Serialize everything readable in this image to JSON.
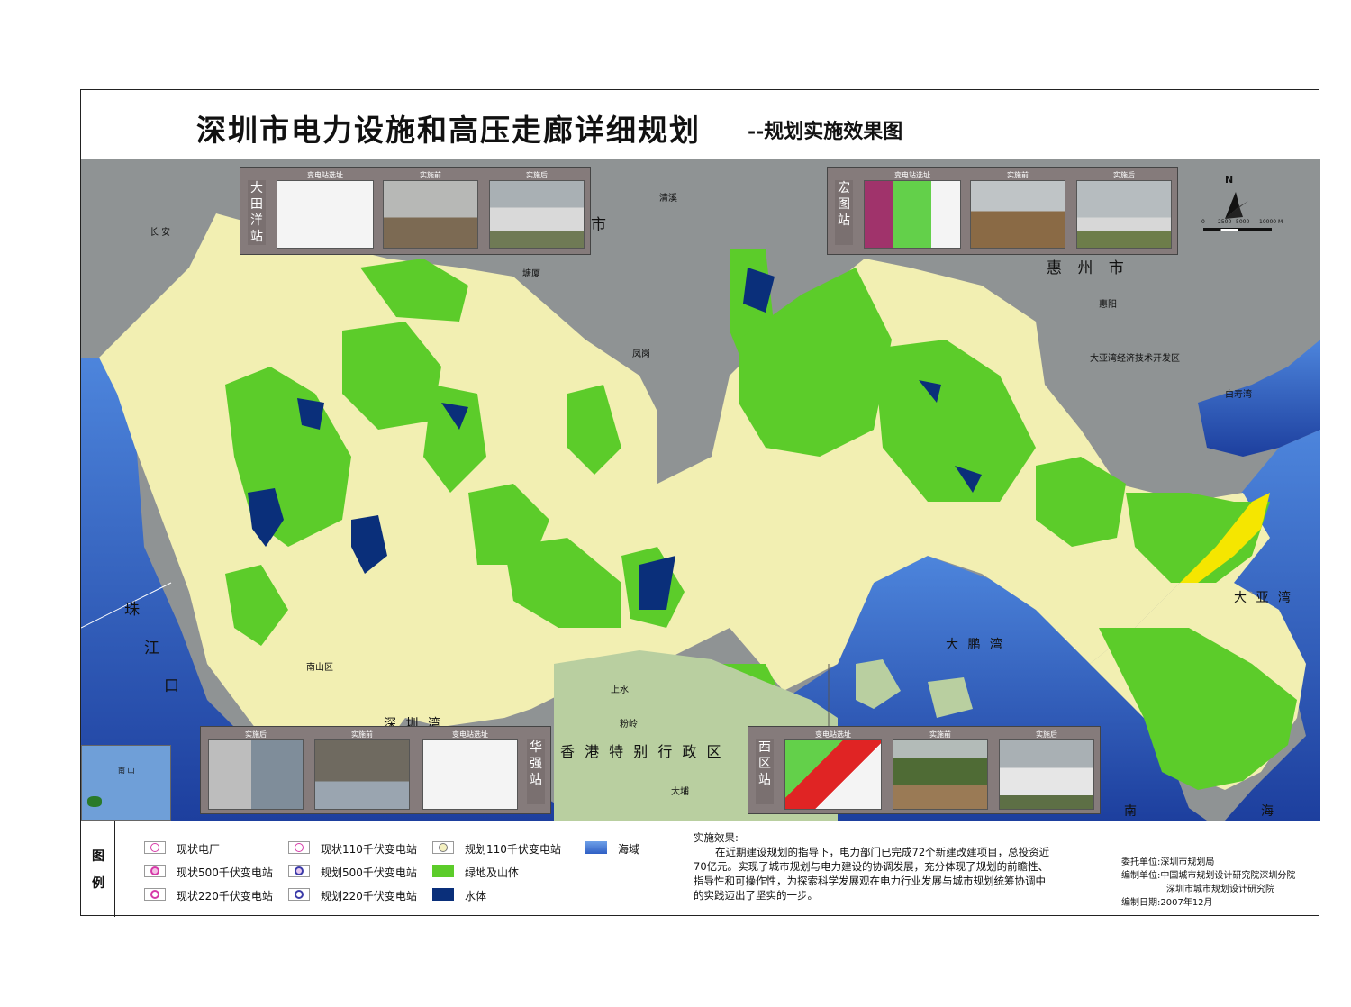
{
  "title": "深圳市电力设施和高压走廊详细规划",
  "subtitle": "--规划实施效果图",
  "map_labels": {
    "huizhou": "惠 州 市",
    "dongguan_tail": "市",
    "zhujiangkou_1": "珠",
    "zhujiangkou_2": "江",
    "zhujiangkou_3": "口",
    "shenzhen_bay": "深 圳 湾",
    "hk": "香 港 特 别 行 政 区",
    "dapeng_bay": "大 鹏 湾",
    "daya_bay": "大 亚 湾",
    "south_sea_1": "南",
    "south_sea_2": "海",
    "qingxi": "清溪",
    "tangxia": "塘厦",
    "fenggang": "凤岗",
    "changan": "长 安",
    "huiyang": "惠阳",
    "daya_dev": "大亚湾经济技术开发区",
    "baishou": "白寿湾",
    "shangshui": "上水",
    "fenling": "粉岭",
    "dabu": "大埔",
    "nanshan_dist": "南山区",
    "nanshan_inset": "南 山"
  },
  "insets": [
    {
      "station": "大田洋站",
      "captions": [
        "变电站选址",
        "实施前",
        "实施后"
      ]
    },
    {
      "station": "宏图站",
      "captions": [
        "变电站选址",
        "实施前",
        "实施后"
      ]
    },
    {
      "station": "华强站",
      "captions": [
        "实施后",
        "实施前",
        "变电站选址"
      ]
    },
    {
      "station": "西区站",
      "captions": [
        "变电站选址",
        "实施前",
        "实施后"
      ]
    }
  ],
  "compass": {
    "north": "N",
    "scale_ticks": [
      "0",
      "2500",
      "5000",
      "10000 M"
    ]
  },
  "legend": {
    "heading": [
      "图",
      "例"
    ],
    "items": [
      {
        "label": "现状电厂",
        "symbol": "power-plant-icon"
      },
      {
        "label": "现状500千伏变电站",
        "symbol": "substation-500-existing-icon"
      },
      {
        "label": "现状220千伏变电站",
        "symbol": "substation-220-existing-icon"
      },
      {
        "label": "现状110千伏变电站",
        "symbol": "substation-110-existing-icon"
      },
      {
        "label": "规划500千伏变电站",
        "symbol": "substation-500-planned-icon"
      },
      {
        "label": "规划220千伏变电站",
        "symbol": "substation-220-planned-icon"
      },
      {
        "label": "规划110千伏变电站",
        "symbol": "substation-110-planned-icon"
      },
      {
        "label": "绿地及山体",
        "color": "#5ccc2a"
      },
      {
        "label": "水体",
        "color": "#0a2f7a"
      },
      {
        "label": "海域",
        "color": "#3b6fd1"
      }
    ]
  },
  "effect": {
    "heading": "实施效果:",
    "body": "在近期建设规划的指导下，电力部门已完成72个新建改建项目，总投资近70亿元。实现了城市规划与电力建设的协调发展，充分体现了规划的前瞻性、指导性和可操作性，为探索科学发展观在电力行业发展与城市规划统筹协调中的实践迈出了坚实的一步。"
  },
  "credits": {
    "client_label": "委托单位:",
    "client": "深圳市规划局",
    "maker_label": "编制单位:",
    "maker_1": "中国城市规划设计研究院深圳分院",
    "maker_2": "深圳市城市规划设计研究院",
    "date_label": "编制日期:",
    "date": "2007年12月"
  },
  "colors": {
    "urban": "#f2efb2",
    "green": "#5ccc2a",
    "water": "#0a2f7a",
    "sea": "#2f66c9",
    "terrain": "#8f9394",
    "hk_land": "#b9cfa0",
    "yellow_area": "#f5e600"
  }
}
